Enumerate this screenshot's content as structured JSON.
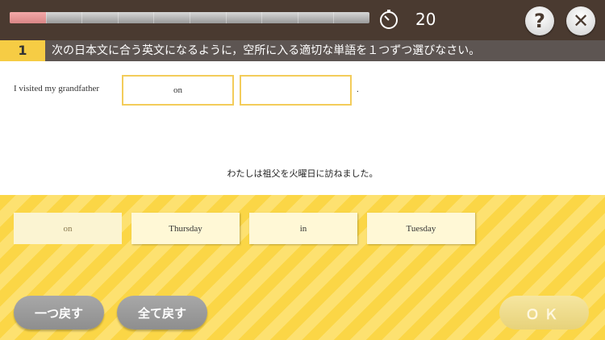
{
  "header": {
    "progress": 0.1,
    "timer_value": "20",
    "help_label": "?",
    "close_label": "✕"
  },
  "question": {
    "number": "1",
    "instruction": "次の日本文に合う英文になるように，空所に入る適切な単語を１つずつ選びなさい。"
  },
  "sentence": {
    "prefix": "I visited my grandfather",
    "blanks": [
      "on",
      ""
    ],
    "suffix": "."
  },
  "translation": "わたしは祖父を火曜日に訪ねました。",
  "choices": [
    {
      "label": "on",
      "used": true
    },
    {
      "label": "Thursday",
      "used": false
    },
    {
      "label": "in",
      "used": false
    },
    {
      "label": "Tuesday",
      "used": false
    }
  ],
  "buttons": {
    "back_one": "一つ戻す",
    "back_all": "全て戻す",
    "ok": "ＯＫ"
  }
}
